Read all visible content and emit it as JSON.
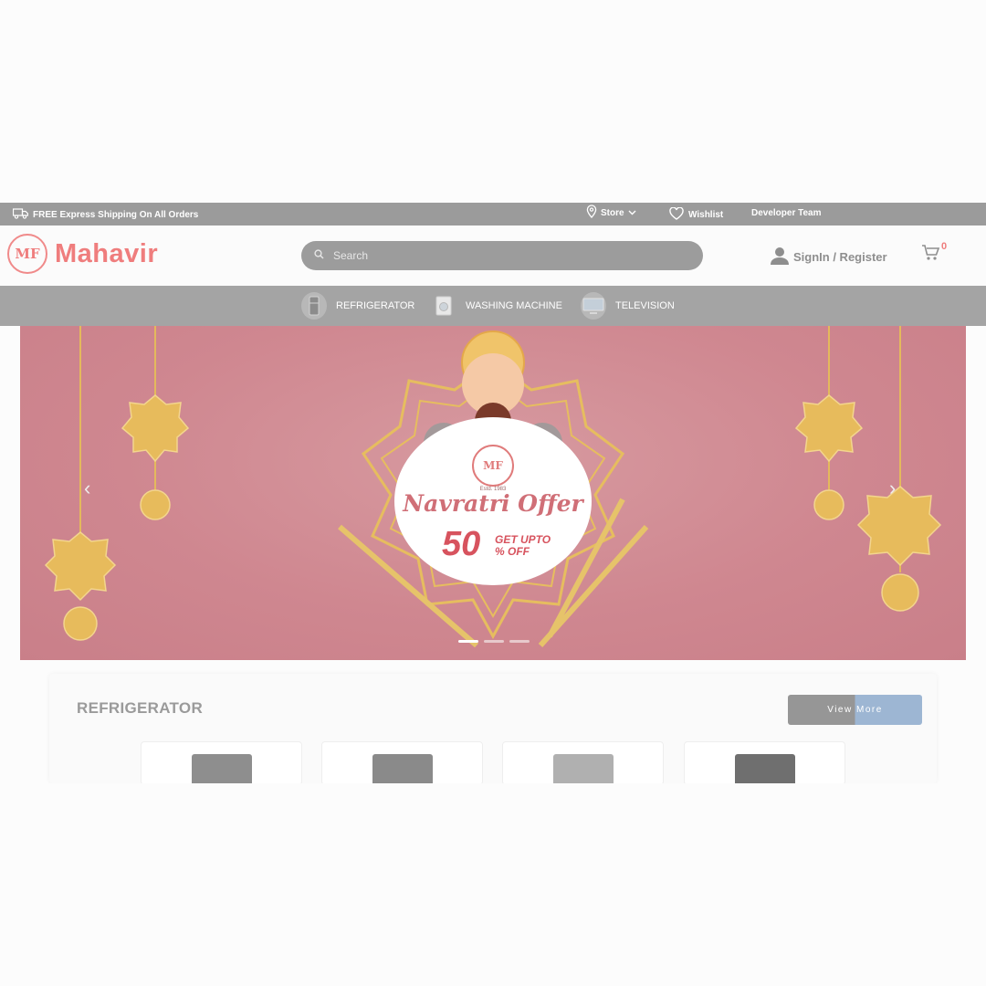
{
  "topbar": {
    "shipping_text": "FREE Express Shipping On All Orders",
    "store_label": "Store",
    "wishlist_label": "Wishlist",
    "developer_label": "Developer Team"
  },
  "header": {
    "logo_mark": "MF",
    "brand_name": "Mahavir",
    "search_placeholder": "Search",
    "signin_label": "SignIn / Register",
    "cart_count": "0"
  },
  "categories": [
    {
      "label": "REFRIGERATOR",
      "icon": "fridge-icon"
    },
    {
      "label": "WASHING MACHINE",
      "icon": "washing-machine-icon"
    },
    {
      "label": "TELEVISION",
      "icon": "television-icon"
    }
  ],
  "banner": {
    "logo_mark": "MF",
    "estd_text": "Estd. 1983",
    "title": "Navratri Offer",
    "discount_number": "50",
    "discount_text_line1": "GET UPTO",
    "discount_text_line2": "% OFF",
    "slide_count": 3,
    "active_slide": 1
  },
  "section": {
    "title": "REFRIGERATOR",
    "view_more_label": "View More",
    "products": [
      {
        "color": "#8e8e8e"
      },
      {
        "color": "#8a8a8a"
      },
      {
        "color": "#b0b0b0"
      },
      {
        "color": "#6f6f6f"
      }
    ]
  },
  "colors": {
    "brand": "#ef7d7d",
    "banner_bg": "#cf8790",
    "topbar_bg": "#9b9b9b",
    "nav_bg": "#a4a4a4",
    "gold": "#e4b95c"
  }
}
